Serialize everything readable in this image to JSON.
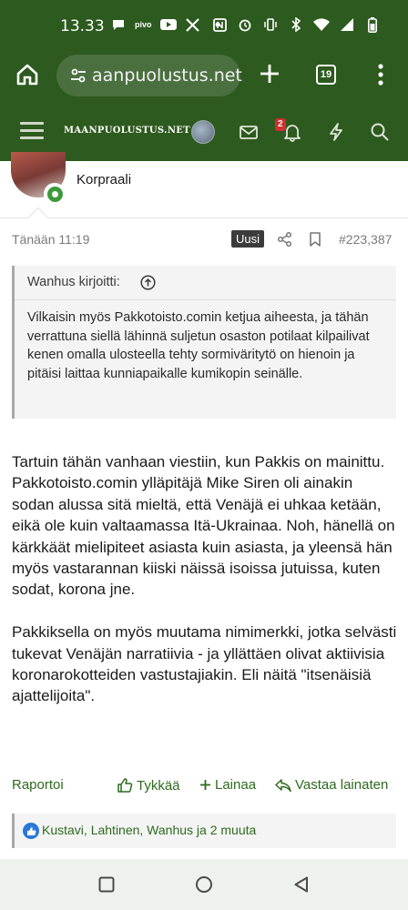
{
  "status_bar": {
    "time": "13.33",
    "pivo_label": "pivo"
  },
  "browser": {
    "url": "aanpuolustus.net",
    "tab_count": "19"
  },
  "site_header": {
    "logo_text": "MAANPUOLUSTUS.NET",
    "alerts_badge": "2"
  },
  "post": {
    "author_rank": "Korpraali",
    "date": "Tänään 11:19",
    "new_badge": "Uusi",
    "post_number": "#223,387",
    "quote": {
      "author_line": "Wanhus kirjoitti:",
      "text": "Vilkaisin myös Pakkotoisto.comin ketjua aiheesta, ja tähän verrattuna siellä lähinnä suljetun osaston potilaat kilpailivat kenen omalla ulosteella tehty sormiväritytö on hienoin ja pitäisi laittaa kunniapaikalle kumikopin seinälle."
    },
    "paragraphs": [
      "Tartuin tähän vanhaan viestiin, kun Pakkis on mainittu. Pakkotoisto.comin ylläpitäjä Mike Siren oli ainakin sodan alussa sitä mieltä, että Venäjä ei uhkaa ketään, eikä ole kuin valtaamassa Itä-Ukrainaa. Noh, hänellä on kärkkäät mielipiteet asiasta kuin asiasta, ja yleensä hän myös vastarannan kiiski näissä isoissa jutuissa, kuten sodat, korona jne.",
      "Pakkiksella on myös muutama nimimerkki, jotka selvästi tukevat Venäjän narratiivia - ja yllättäen olivat aktiivisia koronarokotteiden vastustajiakin. Eli näitä \"itsenäisiä ajattelijoita\"."
    ],
    "actions": {
      "report": "Raportoi",
      "like": "Tykkää",
      "quote": "Lainaa",
      "reply": "Vastaa lainaten"
    },
    "reactions_text": "Kustavi, Lahtinen, Wanhus ja 2 muuta"
  },
  "colors": {
    "brand_green": "#2d5a1e",
    "link_green": "#2d6a1e",
    "like_blue": "#2a78d8",
    "alert_red": "#d03030"
  }
}
